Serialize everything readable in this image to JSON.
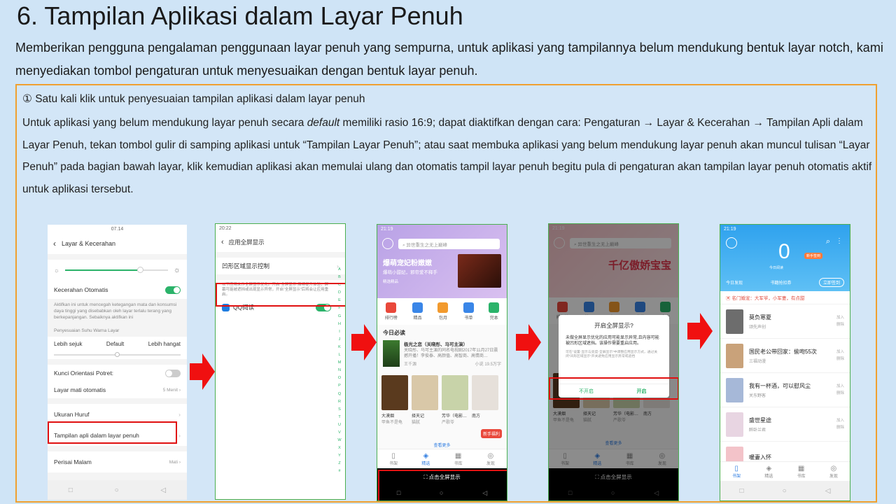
{
  "header": {
    "title": "6. Tampilan Aplikasi dalam Layar Penuh",
    "subtitle": "Memberikan pengguna pengalaman penggunaan layar penuh yang sempurna, untuk aplikasi yang tampilannya belum mendukung bentuk layar notch, kami menyediakan tombol pengaturan untuk menyesuaikan dengan bentuk layar penuh."
  },
  "box": {
    "heading": "① Satu kali klik untuk penyesuaian tampilan aplikasi dalam layar penuh",
    "desc_pre": "Untuk aplikasi yang belum mendukung layar penuh secara ",
    "desc_em": "default",
    "desc_post": " memiliki rasio 16:9; dapat diaktifkan dengan cara: Pengaturan → Layar & Kecerahan → Tampilan Apli dalam Layar Penuh, tekan tombol gulir di samping aplikasi untuk “Tampilan Layar Penuh”; atau saat membuka aplikasi yang belum mendukung layar penuh akan muncul tulisan “Layar Penuh” pada bagian bawah layar, klik kemudian aplikasi akan memulai ulang dan otomatis tampil layar penuh begitu pula di pengaturan akan tampilan layar penuh otomatis aktif untuk aplikasi tersebut."
  },
  "phone1": {
    "time": "07.14",
    "title": "Layar & Kecerahan",
    "auto_brightness": "Kecerahan Otomatis",
    "note": "Aktifkan ini untuk mencegah ketegangan mata dan konsumsi daya tinggi yang disebabkan oleh layar terlalu terang yang berkepanjangan. Sebaiknya aktifkan ini",
    "color_temp": "Penyesuaian Suhu Warna Layar",
    "warm_left": "Lebih sejuk",
    "warm_mid": "Default",
    "warm_right": "Lebih hangat",
    "rotation_lock": "Kunci Orientasi Potret:",
    "screen_off": "Layar mati otomatis",
    "screen_off_val": "5 Menit",
    "font_size": "Ukuran Huruf",
    "fullscreen_apps": "Tampilan apli dalam layar penuh",
    "night_shield": "Perisai Malam",
    "night_val": "Mati"
  },
  "phone2": {
    "time": "20:22",
    "title": "应用全屏显示",
    "notch_ctrl": "凹形区域显示控制",
    "note": "以下应用未作全屏显示优化。开启“全屏显示”后将提升体验，屏幕可能被遮挡或出现显示异常，开启“全屏显示”后将会让应用重启。",
    "app_name": "QQ阅读",
    "alphabet": [
      "A",
      "B",
      "C",
      "D",
      "E",
      "F",
      "G",
      "H",
      "I",
      "J",
      "K",
      "L",
      "M",
      "N",
      "O",
      "P",
      "Q",
      "R",
      "S",
      "T",
      "U",
      "V",
      "W",
      "X",
      "Y",
      "Z",
      "#"
    ]
  },
  "phone3": {
    "time": "21:19",
    "search": "异世重生之无上巅峰",
    "banner_title": "爆萌宠妃粉嫩嫩",
    "banner_sub": "爆萌小甜妃，邪帝爱不释手",
    "banner_small": "精选精品",
    "cats": [
      "排行榜",
      "精品",
      "包月",
      "书单",
      "完本"
    ],
    "today": "今日必读",
    "book_title": "极光之恋（关晓彤、马可主演）",
    "book_desc": "关晓彤、马可主演的同名电视剧2017年11月27日震撼开播！李俊泰、高颜值、高智商、高情商…",
    "author": "王千源",
    "tag1": "小说",
    "tag2": "19.5万字",
    "books": [
      "大漠烟",
      "择天记",
      "芳华（电影…",
      "南方"
    ],
    "bauthors": [
      "甲鱼不是龟",
      "猫腻",
      "严歌苓",
      ""
    ],
    "more": "查看更多",
    "promo": "新手福利",
    "tabs": [
      "书架",
      "精选",
      "书库",
      "发现"
    ],
    "fullscreen_btn": "点击全屏显示"
  },
  "phone4": {
    "time": "21:19",
    "search": "异世重生之无上巅峰",
    "banner": "千亿傲娇宝宝",
    "dialog_title": "开启全屏显示?",
    "dialog_body": "未做全屏显示优化的应用可能显示异常,且内容可能被凹形区域遮挡。该操作需要重启应用。",
    "dialog_note": "可在“设置-显示与亮度-全屏显示”中调整应用显示方式，通过关闭“凹形区域显示”开关避免应用显示异常或遮挡",
    "btn_no": "不开启",
    "btn_yes": "开启",
    "books": [
      "大漠烟",
      "择天记",
      "芳华（电影…",
      "南方"
    ],
    "bauthors": [
      "甲鱼不是龟",
      "猫腻",
      "严歌苓",
      ""
    ],
    "more": "查看更多",
    "tabs": [
      "书架",
      "精选",
      "书库",
      "发现"
    ],
    "fullscreen_btn": "点击全屏显示"
  },
  "phone5": {
    "time": "21:19",
    "minutes": "0",
    "minutes_label": "今日阅读",
    "gift": "新手签到",
    "today_read": "今日发现",
    "checkin": "书籍抢扣券",
    "signin_btn": "立即签到",
    "notice": "名门婚宠：大军爷，小军妻，有点甜",
    "books": [
      {
        "title": "莫负寒夏",
        "author": "颂先声创",
        "r1": "加入",
        "r2": "删除"
      },
      {
        "title": "国民老公带回家：偷吻55次",
        "author": "三福动漫",
        "r1": "加入",
        "r2": "删除"
      },
      {
        "title": "我有一杯酒，可以慰风尘",
        "author": "关东野客",
        "r1": "加入",
        "r2": "删除"
      },
      {
        "title": "盛世星途",
        "author": "醉卧兰君",
        "r1": "加入",
        "r2": "删除"
      },
      {
        "title": "暖妻入怀",
        "author": "",
        "r1": "",
        "r2": ""
      }
    ],
    "tabs": [
      "书架",
      "精选",
      "书库",
      "发现"
    ]
  }
}
